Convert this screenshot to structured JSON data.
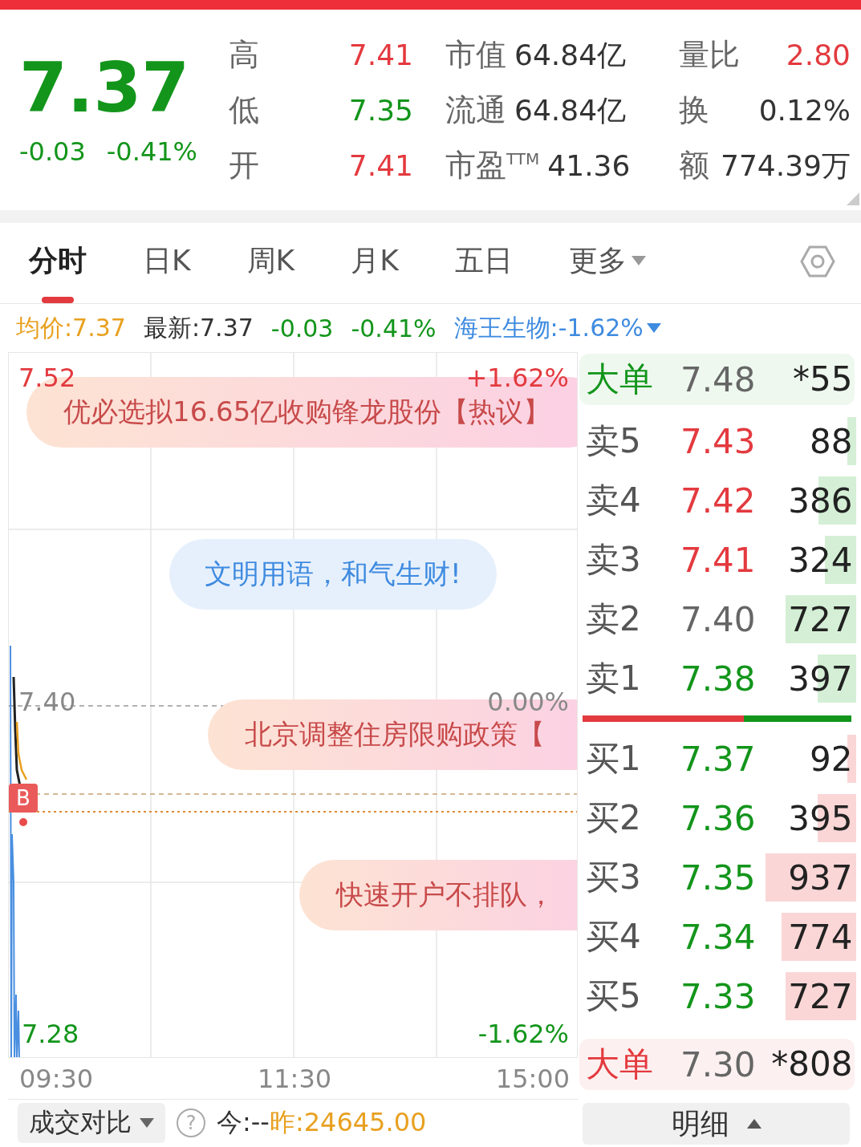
{
  "quote": {
    "price": "7.37",
    "change": "-0.03",
    "change_pct": "-0.41%",
    "color": "#13951b",
    "stats": [
      [
        {
          "label": "高",
          "value": "7.41",
          "color": "#e33a3f"
        },
        {
          "label": "市值",
          "value": "64.84亿",
          "color": "#333333"
        },
        {
          "label": "量比",
          "value": "2.80",
          "color": "#e33a3f"
        }
      ],
      [
        {
          "label": "低",
          "value": "7.35",
          "color": "#13951b"
        },
        {
          "label": "流通",
          "value": "64.84亿",
          "color": "#333333"
        },
        {
          "label": "换",
          "value": "0.12%",
          "color": "#333333"
        }
      ],
      [
        {
          "label": "开",
          "value": "7.41",
          "color": "#e33a3f"
        },
        {
          "label": "市盈$^{TTM}$",
          "value": "41.36",
          "color": "#333333"
        },
        {
          "label": "额",
          "value": "774.39万",
          "color": "#333333"
        }
      ]
    ]
  },
  "tabs": [
    {
      "label": "分时",
      "selected": true,
      "dropdown": false
    },
    {
      "label": "日K",
      "selected": false,
      "dropdown": false
    },
    {
      "label": "周K",
      "selected": false,
      "dropdown": false
    },
    {
      "label": "月K",
      "selected": false,
      "dropdown": false
    },
    {
      "label": "五日",
      "selected": false,
      "dropdown": false
    },
    {
      "label": "更多",
      "selected": false,
      "dropdown": true
    }
  ],
  "info_bar": {
    "avg_price": "均价:7.37",
    "latest": "最新:7.37",
    "change": "-0.03",
    "change_pct": "-0.41%",
    "sector": "海王生物:-1.62%"
  },
  "chart": {
    "y_labels": [
      {
        "text": "7.52",
        "color": "#e33a3f"
      },
      {
        "text": "+1.62%",
        "color": "#e33a3f"
      },
      {
        "text": "7.40",
        "color": "#888888"
      },
      {
        "text": "0.00%",
        "color": "#888888"
      },
      {
        "text": "7.28",
        "color": "#13951b"
      },
      {
        "text": "-1.62%",
        "color": "#13951b"
      }
    ],
    "x_labels": [
      "09:30",
      "11:30",
      "15:00"
    ],
    "marker": "B",
    "news": [
      {
        "text": "优必选拟16.65亿收购锋龙股份【热议】",
        "kind": "hot"
      },
      {
        "text": "文明用语，和气生财!",
        "kind": "notice"
      },
      {
        "text": "北京调整住房限购政策【",
        "kind": "hot"
      },
      {
        "text": "快速开户不排队，",
        "kind": "hot"
      }
    ]
  },
  "order_book": [
    {
      "kind": "big_sell",
      "label": "大单",
      "price": "7.48",
      "volume": "*55"
    },
    {
      "kind": "sell",
      "label": "卖5",
      "price": "7.43",
      "color": "#e33a3f",
      "volume": "88"
    },
    {
      "kind": "sell",
      "label": "卖4",
      "price": "7.42",
      "color": "#e33a3f",
      "volume": "386"
    },
    {
      "kind": "sell",
      "label": "卖3",
      "price": "7.41",
      "color": "#e33a3f",
      "volume": "324"
    },
    {
      "kind": "sell",
      "label": "卖2",
      "price": "7.40",
      "color": "#666666",
      "volume": "727"
    },
    {
      "kind": "sell",
      "label": "卖1",
      "price": "7.38",
      "color": "#13951b",
      "volume": "397"
    },
    {
      "kind": "ratio",
      "level": 0.6
    },
    {
      "kind": "buy",
      "label": "买1",
      "price": "7.37",
      "color": "#13951b",
      "volume": "92"
    },
    {
      "kind": "buy",
      "label": "买2",
      "price": "7.36",
      "color": "#13951b",
      "volume": "395"
    },
    {
      "kind": "buy",
      "label": "买3",
      "price": "7.35",
      "color": "#13951b",
      "volume": "937"
    },
    {
      "kind": "buy",
      "label": "买4",
      "price": "7.34",
      "color": "#13951b",
      "volume": "774"
    },
    {
      "kind": "buy",
      "label": "买5",
      "price": "7.33",
      "color": "#13951b",
      "volume": "727"
    },
    {
      "kind": "big_buy",
      "label": "大单",
      "price": "7.30",
      "volume": "*808"
    }
  ],
  "footer": {
    "compare": "成交对比",
    "help": "?",
    "today": "今:--",
    "yesterday": "昨:24645.00",
    "detail": "明细"
  }
}
